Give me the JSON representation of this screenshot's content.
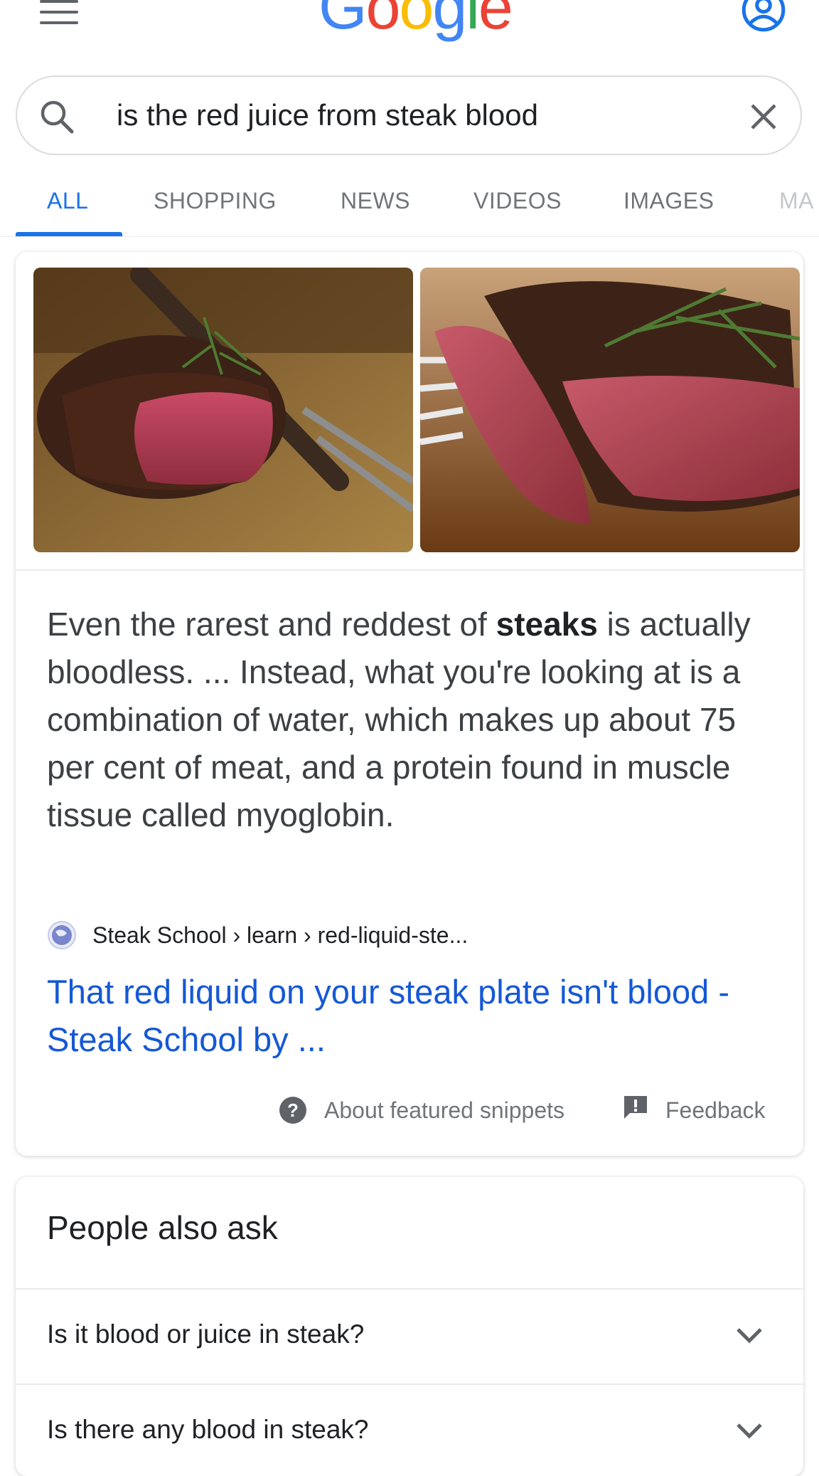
{
  "header": {
    "logo": [
      "G",
      "o",
      "o",
      "g",
      "l",
      "e"
    ]
  },
  "search": {
    "query": "is the red juice from steak blood"
  },
  "tabs": [
    {
      "label": "ALL",
      "active": true
    },
    {
      "label": "SHOPPING",
      "active": false
    },
    {
      "label": "NEWS",
      "active": false
    },
    {
      "label": "VIDEOS",
      "active": false
    },
    {
      "label": "IMAGES",
      "active": false
    },
    {
      "label": "MA",
      "active": false
    }
  ],
  "featured": {
    "images": [
      "steak-image-1",
      "steak-image-2"
    ],
    "snippet_before": "Even the rarest and reddest of ",
    "snippet_bold": "steaks",
    "snippet_after": " is actually bloodless. ... Instead, what you're looking at is a combination of water, which makes up about 75 per cent of meat, and a protein found in muscle tissue called myoglobin.",
    "source": "Steak School › learn › red-liquid-ste...",
    "link_title": "That red liquid on your steak plate isn't blood - Steak School by ...",
    "about_label": "About featured snippets",
    "feedback_label": "Feedback"
  },
  "people_also_ask": {
    "title": "People also ask",
    "questions": [
      "Is it blood or juice in steak?",
      "Is there any blood in steak?"
    ]
  },
  "colors": {
    "accent": "#1a73e8",
    "link": "#1558d6",
    "muted": "#70757a"
  }
}
